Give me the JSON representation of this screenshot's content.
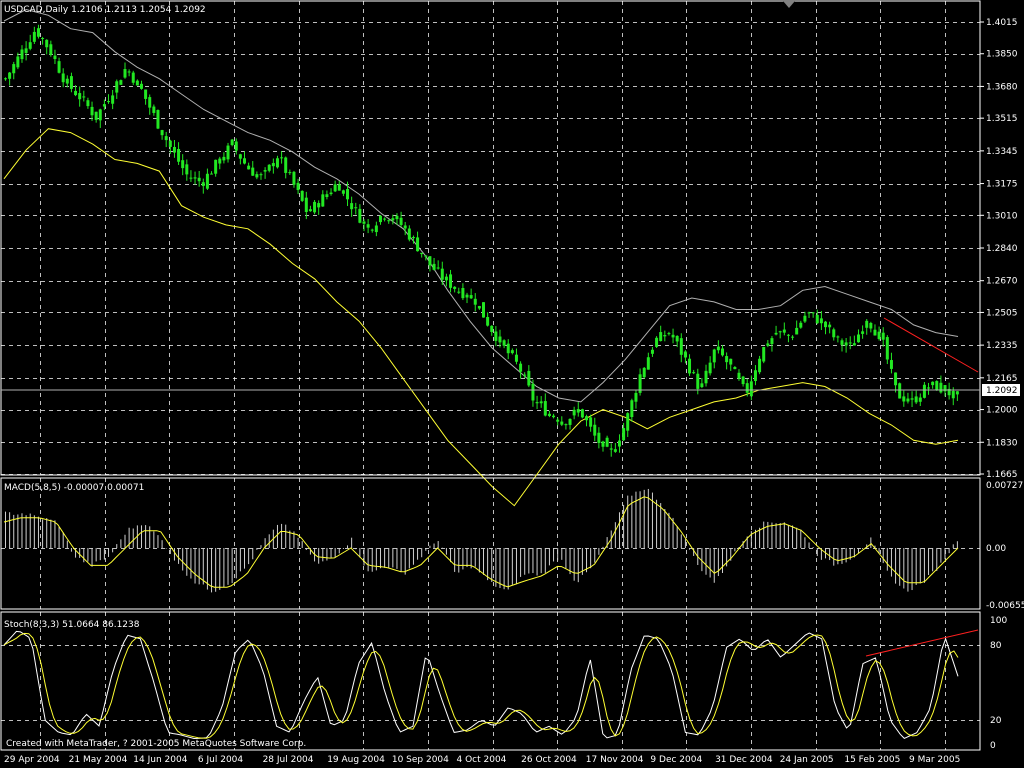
{
  "colors": {
    "background": "#000000",
    "grid": "#ffffff",
    "candle": "#22e822",
    "band": "#ffff33",
    "outer_band": "#b0b0b0",
    "trendline": "#ff2020",
    "histogram": "#d0d0d0",
    "text": "#ffffff"
  },
  "main": {
    "header": "USDCAD,Daily  1.2106 1.2113 1.2054 1.2092",
    "current_price_label": "1.2092"
  },
  "macd": {
    "header": "MACD(5,8,5) -0.00007 0.00071"
  },
  "stoch": {
    "header": "Stoch(8,3,3) 51.0664 86.1238"
  },
  "footer": "Created with MetaTrader, ? 2001-2005 MetaQuotes Software Corp.",
  "chart_data": [
    {
      "type": "candlestick",
      "symbol": "USDCAD",
      "timeframe": "Daily",
      "last": {
        "open": 1.2106,
        "high": 1.2113,
        "low": 1.2054,
        "close": 1.2092
      },
      "y_ticks": [
        "1.4015",
        "1.3850",
        "1.3680",
        "1.3515",
        "1.3345",
        "1.3175",
        "1.3010",
        "1.2840",
        "1.2670",
        "1.2505",
        "1.2335",
        "1.2165",
        "1.2000",
        "1.1830",
        "1.1665"
      ],
      "ylim": [
        1.1665,
        1.4015
      ],
      "x_ticks": [
        "29 Apr 2004",
        "21 May 2004",
        "14 Jun 2004",
        "6 Jul 2004",
        "28 Jul 2004",
        "19 Aug 2004",
        "10 Sep 2004",
        "4 Oct 2004",
        "26 Oct 2004",
        "17 Nov 2004",
        "9 Dec 2004",
        "31 Dec 2004",
        "24 Jan 2005",
        "15 Feb 2005",
        "9 Mar 2005"
      ],
      "close_path": [
        1.372,
        1.385,
        1.398,
        1.386,
        1.37,
        1.362,
        1.352,
        1.365,
        1.378,
        1.366,
        1.35,
        1.335,
        1.322,
        1.318,
        1.328,
        1.338,
        1.326,
        1.32,
        1.332,
        1.318,
        1.302,
        1.31,
        1.318,
        1.305,
        1.294,
        1.302,
        1.298,
        1.288,
        1.276,
        1.268,
        1.262,
        1.258,
        1.244,
        1.232,
        1.222,
        1.204,
        1.198,
        1.194,
        1.2,
        1.186,
        1.176,
        1.192,
        1.218,
        1.236,
        1.24,
        1.226,
        1.21,
        1.232,
        1.222,
        1.208,
        1.23,
        1.24,
        1.238,
        1.25,
        1.246,
        1.236,
        1.232,
        1.248,
        1.236,
        1.208,
        1.204,
        1.212,
        1.212,
        1.205
      ],
      "bands_upper": [
        1.402,
        1.408,
        1.405,
        1.398,
        1.396,
        1.386,
        1.378,
        1.372,
        1.364,
        1.356,
        1.35,
        1.344,
        1.34,
        1.334,
        1.326,
        1.32,
        1.312,
        1.302,
        1.294,
        1.28,
        1.262,
        1.246,
        1.232,
        1.222,
        1.212,
        1.206,
        1.204,
        1.214,
        1.226,
        1.24,
        1.254,
        1.258,
        1.256,
        1.252,
        1.252,
        1.254,
        1.262,
        1.264,
        1.26,
        1.256,
        1.252,
        1.244,
        1.24,
        1.238
      ],
      "bands_lower": [
        1.32,
        1.335,
        1.346,
        1.344,
        1.338,
        1.33,
        1.328,
        1.324,
        1.306,
        1.3,
        1.296,
        1.294,
        1.286,
        1.276,
        1.268,
        1.256,
        1.246,
        1.232,
        1.216,
        1.2,
        1.184,
        1.172,
        1.16,
        1.15,
        1.166,
        1.182,
        1.194,
        1.2,
        1.196,
        1.19,
        1.196,
        1.2,
        1.204,
        1.206,
        1.21,
        1.212,
        1.214,
        1.212,
        1.206,
        1.198,
        1.192,
        1.184,
        1.182,
        1.184
      ]
    },
    {
      "type": "bar",
      "name": "MACD(5,8,5)",
      "last": {
        "macd": -7e-05,
        "signal": 0.00071
      },
      "y_ticks": [
        "0.00727",
        "0.00",
        "-0.00655"
      ],
      "ylim": [
        -0.00655,
        0.00727
      ],
      "histogram_path": [
        0.004,
        0.004,
        0.0035,
        0.003,
        -0.001,
        -0.002,
        -0.001,
        0.002,
        0.003,
        0.001,
        -0.002,
        -0.004,
        -0.005,
        -0.004,
        -0.002,
        0.001,
        0.003,
        0.001,
        -0.002,
        -0.001,
        0.001,
        -0.003,
        -0.002,
        -0.003,
        -0.001,
        0.001,
        -0.003,
        -0.002,
        -0.004,
        -0.005,
        -0.003,
        -0.003,
        -0.001,
        -0.004,
        -0.002,
        0.002,
        0.006,
        0.007,
        0.005,
        0.002,
        -0.002,
        -0.004,
        -0.001,
        0.002,
        0.003,
        0.003,
        0.002,
        -0.001,
        -0.002,
        -0.001,
        0.001,
        -0.003,
        -0.005,
        -0.004,
        -0.002,
        0.001
      ],
      "signal_path": [
        0.003,
        0.0035,
        0.0035,
        0.003,
        0.0,
        -0.002,
        -0.002,
        0.0,
        0.002,
        0.002,
        -0.001,
        -0.003,
        -0.0045,
        -0.0045,
        -0.003,
        0.0,
        0.002,
        0.0015,
        -0.001,
        -0.0012,
        0.0,
        -0.002,
        -0.0022,
        -0.0028,
        -0.002,
        0.0,
        -0.002,
        -0.002,
        -0.0035,
        -0.0045,
        -0.0038,
        -0.0032,
        -0.002,
        -0.003,
        -0.002,
        0.001,
        0.005,
        0.006,
        0.0045,
        0.002,
        -0.001,
        -0.003,
        -0.001,
        0.0015,
        0.0025,
        0.0028,
        0.002,
        0.0,
        -0.0015,
        -0.001,
        0.0005,
        -0.002,
        -0.004,
        -0.004,
        -0.002,
        0.0
      ]
    },
    {
      "type": "line",
      "name": "Stoch(8,3,3)",
      "last": {
        "main": 51.0664,
        "signal": 86.1238
      },
      "y_ticks": [
        "100",
        "80",
        "20",
        "0"
      ],
      "ylim": [
        0,
        100
      ],
      "stoch_path": [
        80,
        92,
        85,
        20,
        10,
        8,
        25,
        15,
        60,
        88,
        85,
        50,
        10,
        8,
        5,
        6,
        30,
        75,
        85,
        60,
        15,
        10,
        35,
        55,
        15,
        20,
        65,
        82,
        40,
        10,
        15,
        75,
        40,
        10,
        12,
        20,
        15,
        30,
        25,
        10,
        15,
        8,
        22,
        70,
        5,
        8,
        60,
        88,
        85,
        60,
        10,
        8,
        30,
        78,
        85,
        75,
        85,
        70,
        80,
        90,
        85,
        30,
        10,
        65,
        70,
        20,
        5,
        10,
        30,
        88,
        55
      ]
    }
  ]
}
